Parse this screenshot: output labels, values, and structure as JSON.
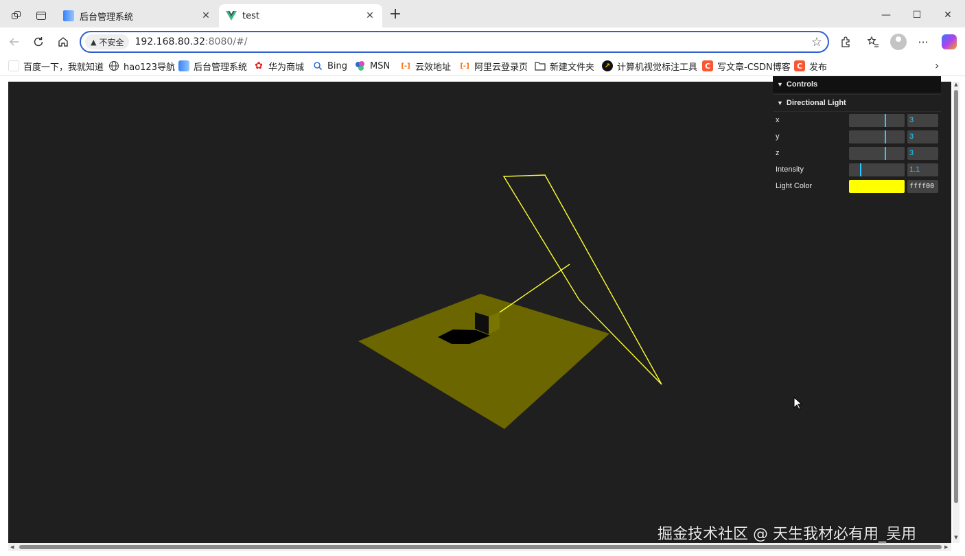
{
  "browser": {
    "tabs": [
      {
        "title": "后台管理系统",
        "active": false
      },
      {
        "title": "test",
        "active": true
      }
    ],
    "new_tab": "+",
    "window_controls": {
      "minimize": "—",
      "maximize": "☐",
      "close": "✕"
    }
  },
  "toolbar": {
    "security_label": "不安全",
    "url_host": "192.168.80.32",
    "url_rest": ":8080/#/"
  },
  "bookmarks": [
    {
      "label": "百度一下，我就知道",
      "icon": "blank-page-icon"
    },
    {
      "label": "hao123导航",
      "icon": "globe-icon"
    },
    {
      "label": "后台管理系统",
      "icon": "page-blue-icon"
    },
    {
      "label": "华为商城",
      "icon": "huawei-icon"
    },
    {
      "label": "Bing",
      "icon": "search-icon"
    },
    {
      "label": "MSN",
      "icon": "msn-icon"
    },
    {
      "label": "云效地址",
      "icon": "aliyun-icon"
    },
    {
      "label": "阿里云登录页",
      "icon": "aliyun-icon"
    },
    {
      "label": "新建文件夹",
      "icon": "folder-icon"
    },
    {
      "label": "计算机视觉标注工具",
      "icon": "arrow-circle-icon"
    },
    {
      "label": "写文章-CSDN博客",
      "icon": "csdn-icon"
    },
    {
      "label": "发布",
      "icon": "csdn-icon"
    }
  ],
  "gui": {
    "title": "Controls",
    "folder": "Directional Light",
    "controls": [
      {
        "label": "x",
        "value": "3",
        "fraction": 0.64
      },
      {
        "label": "y",
        "value": "3",
        "fraction": 0.64
      },
      {
        "label": "z",
        "value": "3",
        "fraction": 0.64
      },
      {
        "label": "Intensity",
        "value": "1.1",
        "fraction": 0.2
      }
    ],
    "color": {
      "label": "Light Color",
      "value": "ffff00",
      "swatch": "#ffff00"
    }
  },
  "scene": {
    "background": "#1f1f1f",
    "plane_color": "#6b6600",
    "helper_color": "#ffff33"
  },
  "watermark": "掘金技术社区 @ 天生我材必有用_吴用"
}
